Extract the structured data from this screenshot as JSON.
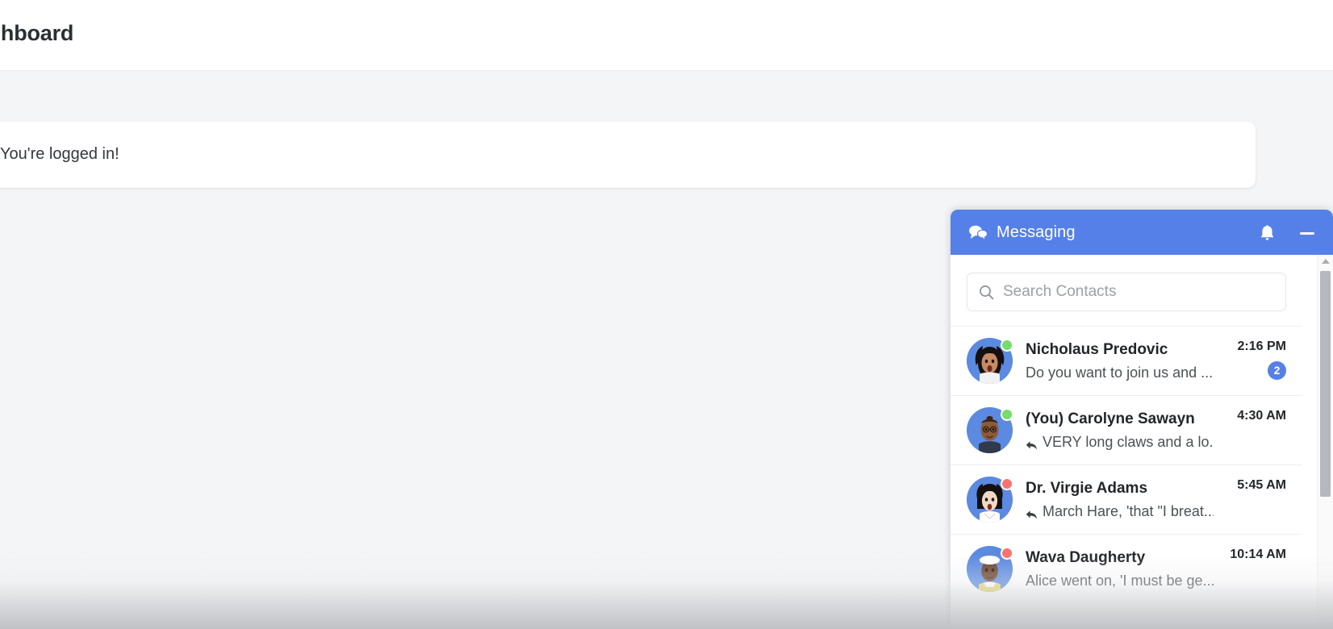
{
  "topbar": {
    "title": "Dashboard"
  },
  "main": {
    "welcome_message": "You're logged in!"
  },
  "messaging": {
    "title": "Messaging",
    "icons": {
      "chat": "chat-bubbles-icon",
      "bell": "bell-icon",
      "minimize": "minimize-icon",
      "search": "search-icon",
      "reply": "reply-arrow-icon",
      "scroll_up": "chevron-up-icon"
    },
    "search": {
      "placeholder": "Search Contacts",
      "value": ""
    },
    "contacts": [
      {
        "name": "Nicholaus Predovic",
        "preview": "Do you want to join us and ...",
        "time": "2:16 PM",
        "status": "online",
        "unread": "2",
        "is_reply": false
      },
      {
        "name": "(You) Carolyne Sawayn",
        "preview": "VERY long claws and a lo...",
        "time": "4:30 AM",
        "status": "online",
        "unread": "",
        "is_reply": true
      },
      {
        "name": "Dr. Virgie Adams",
        "preview": "March Hare, 'that \"I breat...",
        "time": "5:45 AM",
        "status": "offline",
        "unread": "",
        "is_reply": true
      },
      {
        "name": "Wava Daugherty",
        "preview": "Alice went on, 'I must be ge...",
        "time": "10:14 AM",
        "status": "offline",
        "unread": "",
        "is_reply": false
      }
    ]
  },
  "colors": {
    "accent": "#5580e8",
    "page_bg": "#f4f5f7",
    "card_bg": "#ffffff",
    "status_online": "#74dd6b",
    "status_offline": "#f8736f"
  }
}
